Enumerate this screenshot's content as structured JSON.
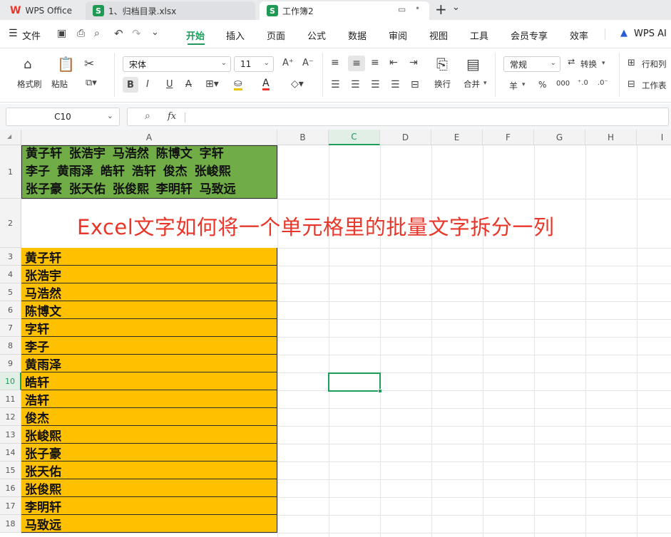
{
  "tabs": {
    "wps": "WPS Office",
    "file1": "1、归档目录.xlsx",
    "file2": "工作簿2",
    "add": "+",
    "more": "⌄"
  },
  "menu": {
    "file": "文件",
    "items": [
      "开始",
      "插入",
      "页面",
      "公式",
      "数据",
      "审阅",
      "视图",
      "工具",
      "会员专享",
      "效率"
    ],
    "ai": "WPS AI"
  },
  "ribbon": {
    "format_painter": "格式刷",
    "paste": "粘贴",
    "font_name": "宋体",
    "font_size": "11",
    "wrap": "换行",
    "merge": "合并",
    "number_format": "常规",
    "convert": "转换",
    "rows_cols": "行和列",
    "worksheet": "工作表",
    "currency": "羊",
    "percent": "%",
    "thousands": "000"
  },
  "formula_bar": {
    "cell_ref": "C10",
    "fx": "fx",
    "value": ""
  },
  "columns": [
    "A",
    "B",
    "C",
    "D",
    "E",
    "F",
    "G",
    "H",
    "I"
  ],
  "rows": [
    "1",
    "2",
    "3",
    "4",
    "5",
    "6",
    "7",
    "8",
    "9",
    "10",
    "11",
    "12",
    "13",
    "14",
    "15",
    "16",
    "17",
    "18"
  ],
  "sheet": {
    "a1_lines": [
      "黄子轩 张浩宇 马浩然 陈博文 字轩",
      "李子 黄雨泽 皓轩 浩轩 俊杰 张峻熙",
      "张子豪 张天佑 张俊熙 李明轩 马致远"
    ],
    "title": "Excel文字如何将一个单元格里的批量文字拆分一列",
    "names": [
      "黄子轩",
      "张浩宇",
      "马浩然",
      "陈博文",
      "字轩",
      "李子",
      "黄雨泽",
      "皓轩",
      "浩轩",
      "俊杰",
      "张峻熙",
      "张子豪",
      "张天佑",
      "张俊熙",
      "李明轩",
      "马致远"
    ],
    "selected_cell": "C10"
  },
  "colors": {
    "green_fill": "#70ad47",
    "orange_fill": "#ffc000",
    "title_red": "#e8372a",
    "accent_green": "#1d9c5a"
  }
}
